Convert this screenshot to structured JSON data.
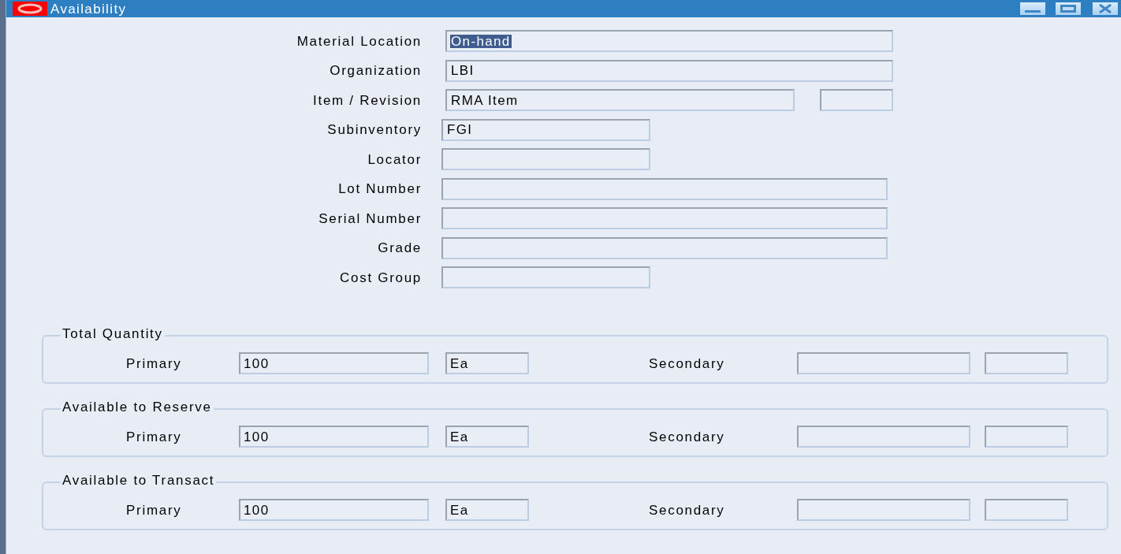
{
  "window": {
    "title": "Availability"
  },
  "fields": [
    {
      "label": "Material Location",
      "kind": "wide",
      "value": "On-hand",
      "highlighted": true
    },
    {
      "label": "Organization",
      "kind": "wide",
      "value": "LBI"
    },
    {
      "label": "Item / Revision",
      "kind": "with_revision",
      "value": "RMA Item"
    },
    {
      "label": "Subinventory",
      "kind": "narrow",
      "value": "FGI"
    },
    {
      "label": "Locator",
      "kind": "narrow"
    },
    {
      "label": "Lot Number",
      "kind": "long"
    },
    {
      "label": "Serial Number",
      "kind": "long"
    },
    {
      "label": "Grade",
      "kind": "long"
    },
    {
      "label": "Cost Group",
      "kind": "narrow"
    }
  ],
  "quantity_groups": [
    {
      "title": "Total Quantity",
      "primary_label": "Primary",
      "primary_value": "100",
      "primary_uom": "Ea",
      "secondary_label": "Secondary"
    },
    {
      "title": "Available to Reserve",
      "primary_label": "Primary",
      "primary_value": "100",
      "primary_uom": "Ea",
      "secondary_label": "Secondary"
    },
    {
      "title": "Available to Transact",
      "primary_label": "Primary",
      "primary_value": "100",
      "primary_uom": "Ea",
      "secondary_label": "Secondary"
    }
  ]
}
